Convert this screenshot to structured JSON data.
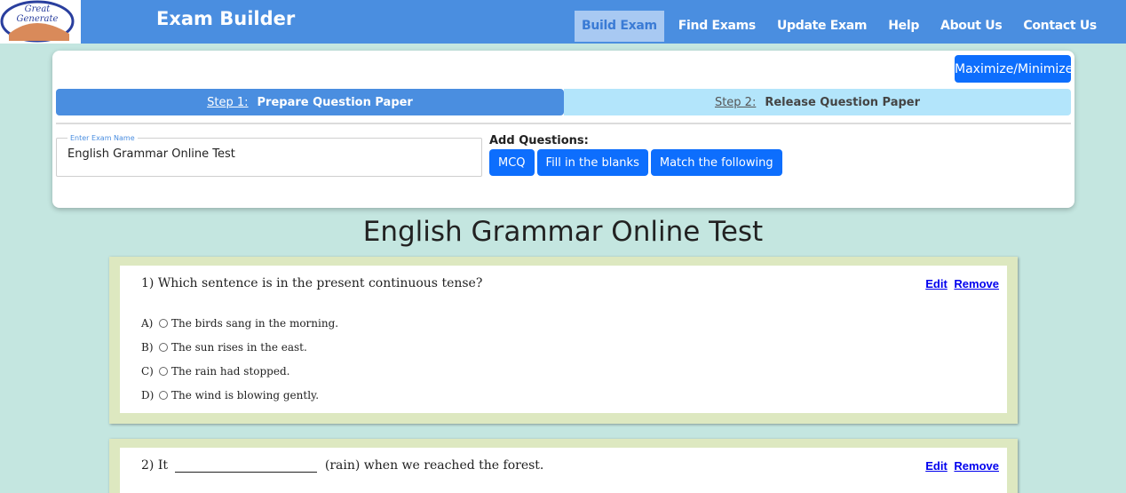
{
  "logo": {
    "line1": "Great",
    "line2": "Generate"
  },
  "header": {
    "title": "Exam Builder",
    "nav": [
      "Build Exam",
      "Find Exams",
      "Update Exam",
      "Help",
      "About Us",
      "Contact Us"
    ],
    "active_nav": "Build Exam"
  },
  "panel": {
    "maximize_label": "Maximize/Minimize",
    "steps": [
      {
        "num": "Step 1:",
        "label": "Prepare Question Paper"
      },
      {
        "num": "Step 2:",
        "label": "Release Question Paper"
      }
    ],
    "exam_name_legend": "Enter Exam Name",
    "exam_name_value": "English Grammar Online Test",
    "add_questions_label": "Add Questions:",
    "question_types": [
      "MCQ",
      "Fill in the blanks",
      "Match the following"
    ]
  },
  "exam_title": "English Grammar Online Test",
  "actions": {
    "edit": "Edit",
    "remove": "Remove"
  },
  "questions": [
    {
      "text": "1) Which sentence is in the present continuous tense?",
      "options": [
        {
          "letter": "A)",
          "text": "The birds sang in the morning."
        },
        {
          "letter": "B)",
          "text": "The sun rises in the east."
        },
        {
          "letter": "C)",
          "text": "The rain had stopped."
        },
        {
          "letter": "D)",
          "text": "The wind is blowing gently."
        }
      ]
    },
    {
      "text_before": "2) It",
      "text_after": "(rain) when we reached the forest."
    }
  ],
  "colors": {
    "background": "#c4e6e0",
    "nav": "#4a8ee0",
    "button": "#0d6efd",
    "card_border": "#dde8c0"
  }
}
